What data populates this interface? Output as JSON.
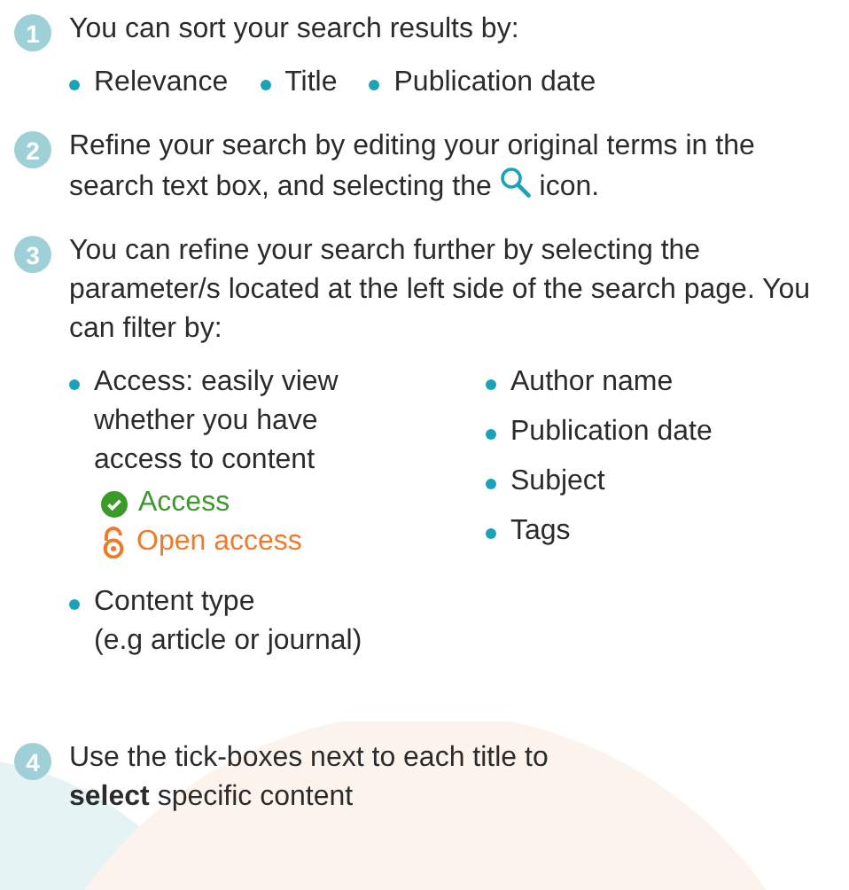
{
  "steps": [
    {
      "number": "1",
      "kind": "sort",
      "text": "You can sort your search results by:",
      "options": [
        "Relevance",
        "Title",
        "Publication date"
      ]
    },
    {
      "number": "2",
      "kind": "icon_text",
      "text_before": "Refine your search by editing your original terms in the search text box, and selecting the",
      "text_after": "icon."
    },
    {
      "number": "3",
      "kind": "filters",
      "text": "You can refine your search further by selecting the parameter/s located at the left side of the search page. You can filter by:",
      "filters_left": [
        {
          "text": "Access: easily view whether you have access to content",
          "badges": [
            {
              "kind": "access",
              "label": "Access"
            },
            {
              "kind": "open_access",
              "label": "Open access"
            }
          ]
        },
        {
          "text": "Content type",
          "note": "(e.g article or journal)"
        }
      ],
      "filters_right": [
        {
          "text": "Author name"
        },
        {
          "text": "Publication date"
        },
        {
          "text": "Subject"
        },
        {
          "text": "Tags"
        }
      ]
    },
    {
      "number": "4",
      "kind": "plain",
      "text": "Use the tick-boxes next to each title to **select** specific content"
    }
  ]
}
